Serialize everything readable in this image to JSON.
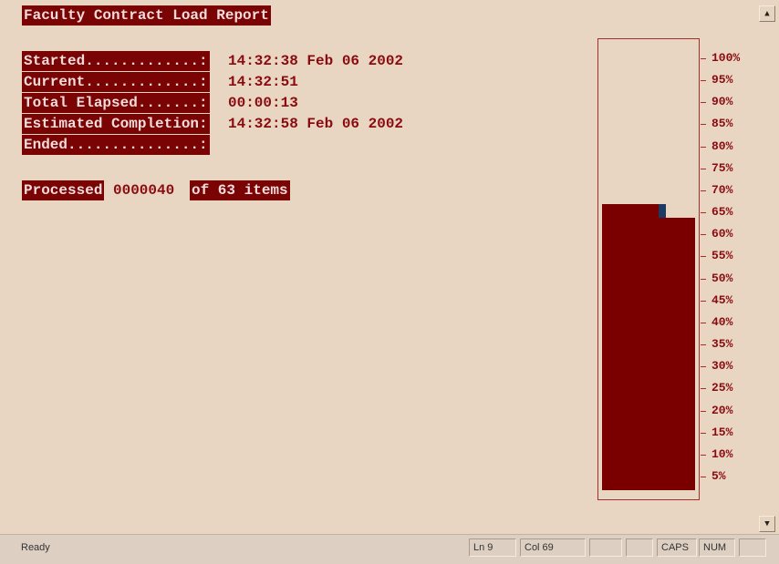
{
  "title": "Faculty Contract Load Report",
  "stats": [
    {
      "label": "Started.............:",
      "value": "14:32:38 Feb 06 2002"
    },
    {
      "label": "Current.............:",
      "value": "14:32:51"
    },
    {
      "label": "Total Elapsed.......:",
      "value": "00:00:13"
    },
    {
      "label": "Estimated Completion:",
      "value": "14:32:58 Feb 06 2002"
    },
    {
      "label": "Ended...............:",
      "value": ""
    }
  ],
  "processed": {
    "label": "Processed",
    "count": "0000040",
    "suffix": "of 63 items"
  },
  "gauge": {
    "progress_percent": 63,
    "tick_labels": [
      "100%",
      "95%",
      "90%",
      "85%",
      "80%",
      "75%",
      "70%",
      "65%",
      "60%",
      "55%",
      "50%",
      "45%",
      "40%",
      "35%",
      "30%",
      "25%",
      "20%",
      "15%",
      "10%",
      "5%"
    ]
  },
  "colors": {
    "accent": "#7a0303",
    "background": "#e8d6c2",
    "text": "#8a0a10"
  },
  "status": {
    "message": "Ready",
    "ln": "Ln 9",
    "col": "Col 69",
    "caps": "CAPS",
    "num": "NUM"
  },
  "icons": {
    "scroll_up": "scroll-up-arrow",
    "scroll_down": "scroll-down-arrow"
  }
}
